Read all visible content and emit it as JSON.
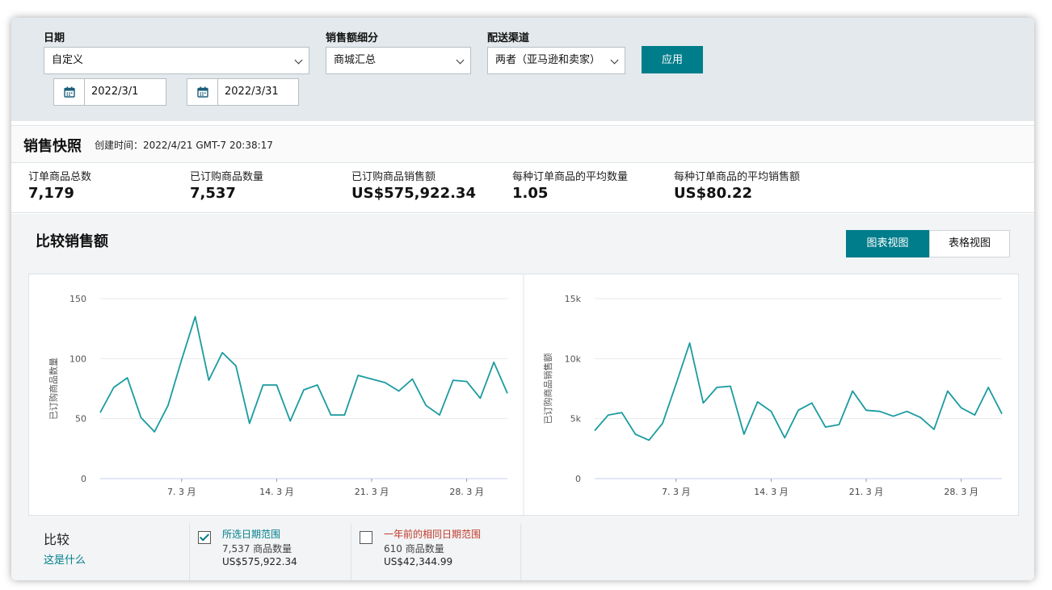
{
  "filters": {
    "date": {
      "label": "日期",
      "value": "自定义",
      "from": "2022/3/1",
      "to": "2022/3/31"
    },
    "breakdown": {
      "label": "销售额细分",
      "value": "商城汇总"
    },
    "channel": {
      "label": "配送渠道",
      "value": "两者（亚马逊和卖家）"
    },
    "apply_label": "应用"
  },
  "snapshot": {
    "title": "销售快照",
    "created": "创建时间：2022/4/21 GMT-7 20:38:17",
    "metrics": [
      {
        "label": "订单商品总数",
        "value": "7,179"
      },
      {
        "label": "已订购商品数量",
        "value": "7,537"
      },
      {
        "label": "已订购商品销售额",
        "value": "US$575,922.34"
      },
      {
        "label": "每种订单商品的平均数量",
        "value": "1.05"
      },
      {
        "label": "每种订单商品的平均销售额",
        "value": "US$80.22"
      }
    ]
  },
  "compare": {
    "title": "比较销售额",
    "view_chart": "图表视图",
    "view_table": "表格视图",
    "label": "比较",
    "whatis": "这是什么",
    "legend": [
      {
        "title": "所选日期范围",
        "line2": "7,537 商品数量",
        "line3": "US$575,922.34",
        "checked": true,
        "color": "#007d8b"
      },
      {
        "title": "一年前的相同日期范围",
        "line2": "610 商品数量",
        "line3": "US$42,344.99",
        "checked": false,
        "color": "#c0392b"
      }
    ]
  },
  "colors": {
    "accent": "#007d8b",
    "line": "#1a9ba0",
    "prior": "#c0392b"
  },
  "chart_data": [
    {
      "type": "line",
      "ylabel": "已订购商品数量",
      "ylim": [
        0,
        150
      ],
      "yticks": [
        "150",
        "100",
        "50",
        "0"
      ],
      "xticks": [
        "7. 3 月",
        "14. 3 月",
        "21. 3 月",
        "28. 3 月"
      ],
      "x": [
        1,
        2,
        3,
        4,
        5,
        6,
        7,
        8,
        9,
        10,
        11,
        12,
        13,
        14,
        15,
        16,
        17,
        18,
        19,
        20,
        21,
        22,
        23,
        24,
        25,
        26,
        27,
        28,
        29,
        30,
        31
      ],
      "series": [
        {
          "values": [
            55,
            76,
            84,
            51,
            39,
            61,
            99,
            135,
            82,
            105,
            94,
            46,
            78,
            78,
            48,
            74,
            78,
            53,
            53,
            86,
            83,
            80,
            73,
            83,
            61,
            53,
            82,
            81,
            67,
            97,
            71
          ]
        }
      ]
    },
    {
      "type": "line",
      "ylabel": "已订购商品销售额",
      "ylim": [
        0,
        15000
      ],
      "yticks": [
        "15k",
        "10k",
        "5k",
        "0"
      ],
      "xticks": [
        "7. 3 月",
        "14. 3 月",
        "21. 3 月",
        "28. 3 月"
      ],
      "x": [
        1,
        2,
        3,
        4,
        5,
        6,
        7,
        8,
        9,
        10,
        11,
        12,
        13,
        14,
        15,
        16,
        17,
        18,
        19,
        20,
        21,
        22,
        23,
        24,
        25,
        26,
        27,
        28,
        29,
        30,
        31
      ],
      "series": [
        {
          "values": [
            4000,
            5300,
            5500,
            3700,
            3200,
            4600,
            7900,
            11300,
            6300,
            7600,
            7700,
            3700,
            6400,
            5600,
            3400,
            5700,
            6300,
            4300,
            4500,
            7300,
            5700,
            5600,
            5200,
            5600,
            5100,
            4100,
            7300,
            5900,
            5300,
            7600,
            5400
          ]
        }
      ]
    }
  ]
}
